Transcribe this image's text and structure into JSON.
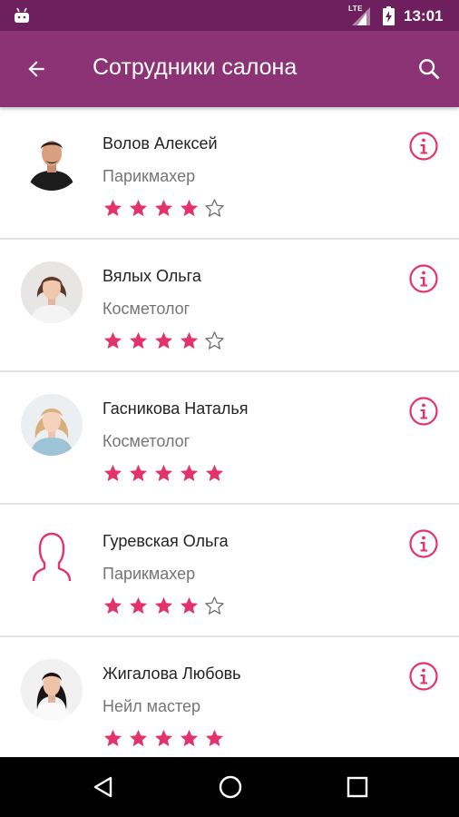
{
  "status_bar": {
    "network": "LTE",
    "time": "13:01"
  },
  "app_bar": {
    "title": "Сотрудники салона"
  },
  "colors": {
    "status_bar": "#6e1f5e",
    "app_bar": "#8b3375",
    "accent": "#e2336b"
  },
  "employees": [
    {
      "name": "Волов Алексей",
      "role": "Парикмахер",
      "rating": 4,
      "avatar": "photo-man"
    },
    {
      "name": "Вялых Ольга",
      "role": "Косметолог",
      "rating": 4,
      "avatar": "photo-woman-dark-hair"
    },
    {
      "name": "Гасникова Наталья",
      "role": "Косметолог",
      "rating": 5,
      "avatar": "photo-woman-blonde"
    },
    {
      "name": "Гуревская Ольга",
      "role": "Парикмахер",
      "rating": 4,
      "avatar": "person-outline-icon"
    },
    {
      "name": "Жигалова Любовь",
      "role": "Нейл мастер",
      "rating": 5,
      "avatar": "photo-woman-black-hair"
    }
  ]
}
